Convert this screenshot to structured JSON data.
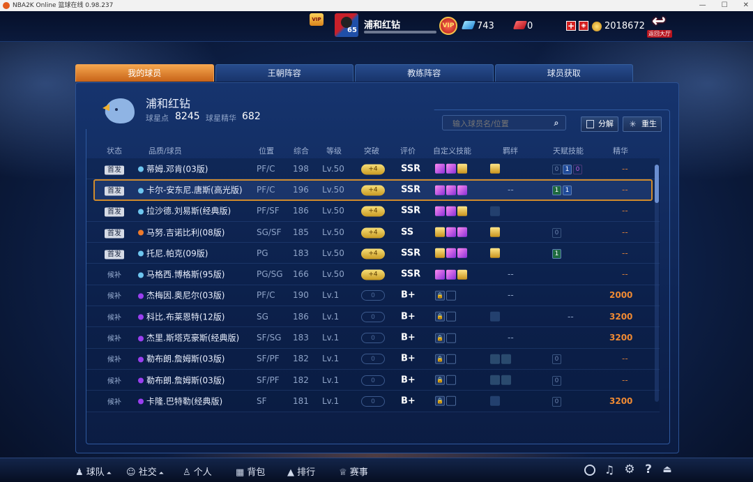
{
  "window": {
    "title": "NBA2K Online 篮球在线 0.98.237",
    "minimize": "—",
    "maximize": "☐",
    "close": "✕"
  },
  "topbar": {
    "team_name": "浦和红钻",
    "level": "65",
    "vip": "VIP",
    "diamonds": "743",
    "tickets": "0",
    "coins": "2018672",
    "back_label": "返回大厅"
  },
  "tabs": [
    {
      "label": "我的球员",
      "active": true
    },
    {
      "label": "王朝阵容"
    },
    {
      "label": "教练阵容"
    },
    {
      "label": "球员获取"
    }
  ],
  "team": {
    "name": "浦和红钻",
    "star_points_label": "球星点",
    "star_points": "8245",
    "essence_label": "球星精华",
    "essence": "682"
  },
  "search": {
    "placeholder": "输入球员名/位置"
  },
  "buttons": {
    "decompose": "分解",
    "reborn": "重生"
  },
  "columns": [
    "状态",
    "品质/球员",
    "位置",
    "综合",
    "等级",
    "突破",
    "评价",
    "自定义技能",
    "羁绊",
    "天赋技能",
    "精华"
  ],
  "players": [
    {
      "status": "首发",
      "status_type": "start",
      "quality_color": "#6ec6f0",
      "name": "蒂姆.邓肯(03版)",
      "pos": "PF/C",
      "ovr": "198",
      "level": "Lv.50",
      "breakthrough": "+4",
      "rating": "SSR",
      "skills": [
        "p",
        "p",
        "g"
      ],
      "bond": "gold",
      "talents": [
        {
          "t": "0",
          "k": "d"
        },
        {
          "t": "1",
          "k": "b"
        },
        {
          "t": "0",
          "k": "pu"
        }
      ],
      "essence": "--"
    },
    {
      "status": "首发",
      "status_type": "start",
      "quality_color": "#6ec6f0",
      "name": "卡尔-安东尼.唐斯(高光版)",
      "pos": "PF/C",
      "ovr": "196",
      "level": "Lv.50",
      "breakthrough": "+4",
      "rating": "SSR",
      "skills": [
        "p",
        "p",
        "p"
      ],
      "bond": "dash",
      "talents": [
        {
          "t": "1",
          "k": "g"
        },
        {
          "t": "1",
          "k": "b"
        }
      ],
      "essence": "--",
      "selected": true
    },
    {
      "status": "首发",
      "status_type": "start",
      "quality_color": "#6ec6f0",
      "name": "拉沙德.刘易斯(经典版)",
      "pos": "PF/SF",
      "ovr": "186",
      "level": "Lv.50",
      "breakthrough": "+4",
      "rating": "SSR",
      "skills": [
        "p",
        "p",
        "g"
      ],
      "bond": "dim",
      "talents": [],
      "essence": "--"
    },
    {
      "status": "首发",
      "status_type": "start",
      "quality_color": "#ef7a2a",
      "name": "马努.吉诺比利(08版)",
      "pos": "SG/SF",
      "ovr": "185",
      "level": "Lv.50",
      "breakthrough": "+4",
      "rating": "SS",
      "skills": [
        "g",
        "p",
        "p"
      ],
      "bond": "gold",
      "talents": [
        {
          "t": "0",
          "k": "d"
        }
      ],
      "essence": "--"
    },
    {
      "status": "首发",
      "status_type": "start",
      "quality_color": "#6ec6f0",
      "name": "托尼.帕克(09版)",
      "pos": "PG",
      "ovr": "183",
      "level": "Lv.50",
      "breakthrough": "+4",
      "rating": "SSR",
      "skills": [
        "g",
        "p",
        "p"
      ],
      "bond": "gold",
      "talents": [
        {
          "t": "1",
          "k": "g"
        }
      ],
      "essence": "--"
    },
    {
      "status": "候补",
      "status_type": "bench",
      "quality_color": "#6ec6f0",
      "name": "马格西.博格斯(95版)",
      "pos": "PG/SG",
      "ovr": "166",
      "level": "Lv.50",
      "breakthrough": "+4",
      "rating": "SSR",
      "skills": [
        "p",
        "p",
        "g"
      ],
      "bond": "dash",
      "talents": [],
      "essence": "--"
    },
    {
      "status": "候补",
      "status_type": "bench",
      "quality_color": "#9a3ff0",
      "name": "杰梅因.奥尼尔(03版)",
      "pos": "PF/C",
      "ovr": "190",
      "level": "Lv.1",
      "breakthrough": "0",
      "rating": "B+",
      "skills": [
        "lock",
        "empty"
      ],
      "bond": "dash",
      "talents": [],
      "essence": "2000"
    },
    {
      "status": "候补",
      "status_type": "bench",
      "quality_color": "#9a3ff0",
      "name": "科比.布莱恩特(12版)",
      "pos": "SG",
      "ovr": "186",
      "level": "Lv.1",
      "breakthrough": "0",
      "rating": "B+",
      "skills": [
        "lock",
        "empty"
      ],
      "bond": "dim",
      "talents": [],
      "talent_dash": true,
      "essence": "3200"
    },
    {
      "status": "候补",
      "status_type": "bench",
      "quality_color": "#9a3ff0",
      "name": "杰里.斯塔克豪斯(经典版)",
      "pos": "SF/SG",
      "ovr": "183",
      "level": "Lv.1",
      "breakthrough": "0",
      "rating": "B+",
      "skills": [
        "lock",
        "empty"
      ],
      "bond": "dash",
      "talents": [],
      "essence": "3200"
    },
    {
      "status": "候补",
      "status_type": "bench",
      "quality_color": "#9a3ff0",
      "name": "勒布朗.詹姆斯(03版)",
      "pos": "SF/PF",
      "ovr": "182",
      "level": "Lv.1",
      "breakthrough": "0",
      "rating": "B+",
      "skills": [
        "lock",
        "empty"
      ],
      "bond": "dim2",
      "talents": [
        {
          "t": "0",
          "k": "d"
        }
      ],
      "essence": "--"
    },
    {
      "status": "候补",
      "status_type": "bench",
      "quality_color": "#9a3ff0",
      "name": "勒布朗.詹姆斯(03版)",
      "pos": "SF/PF",
      "ovr": "182",
      "level": "Lv.1",
      "breakthrough": "0",
      "rating": "B+",
      "skills": [
        "lock",
        "empty"
      ],
      "bond": "dim2",
      "talents": [
        {
          "t": "0",
          "k": "d"
        }
      ],
      "essence": "--"
    },
    {
      "status": "候补",
      "status_type": "bench",
      "quality_color": "#9a3ff0",
      "name": "卡隆.巴特勒(经典版)",
      "pos": "SF",
      "ovr": "181",
      "level": "Lv.1",
      "breakthrough": "0",
      "rating": "B+",
      "skills": [
        "lock",
        "empty"
      ],
      "bond": "dim",
      "talents": [
        {
          "t": "0",
          "k": "d"
        }
      ],
      "essence": "3200"
    }
  ],
  "bottom_nav": [
    {
      "label": "球队",
      "icon": "person-icon"
    },
    {
      "label": "社交",
      "icon": "social-icon"
    },
    {
      "label": "个人",
      "icon": "profile-icon"
    },
    {
      "label": "背包",
      "icon": "bag-icon"
    },
    {
      "label": "排行",
      "icon": "ranking-icon"
    },
    {
      "label": "赛事",
      "icon": "trophy-icon"
    }
  ],
  "colors": {
    "accent": "#f0a050",
    "essence": "#f08a33",
    "selected_border": "#d08b2c"
  }
}
